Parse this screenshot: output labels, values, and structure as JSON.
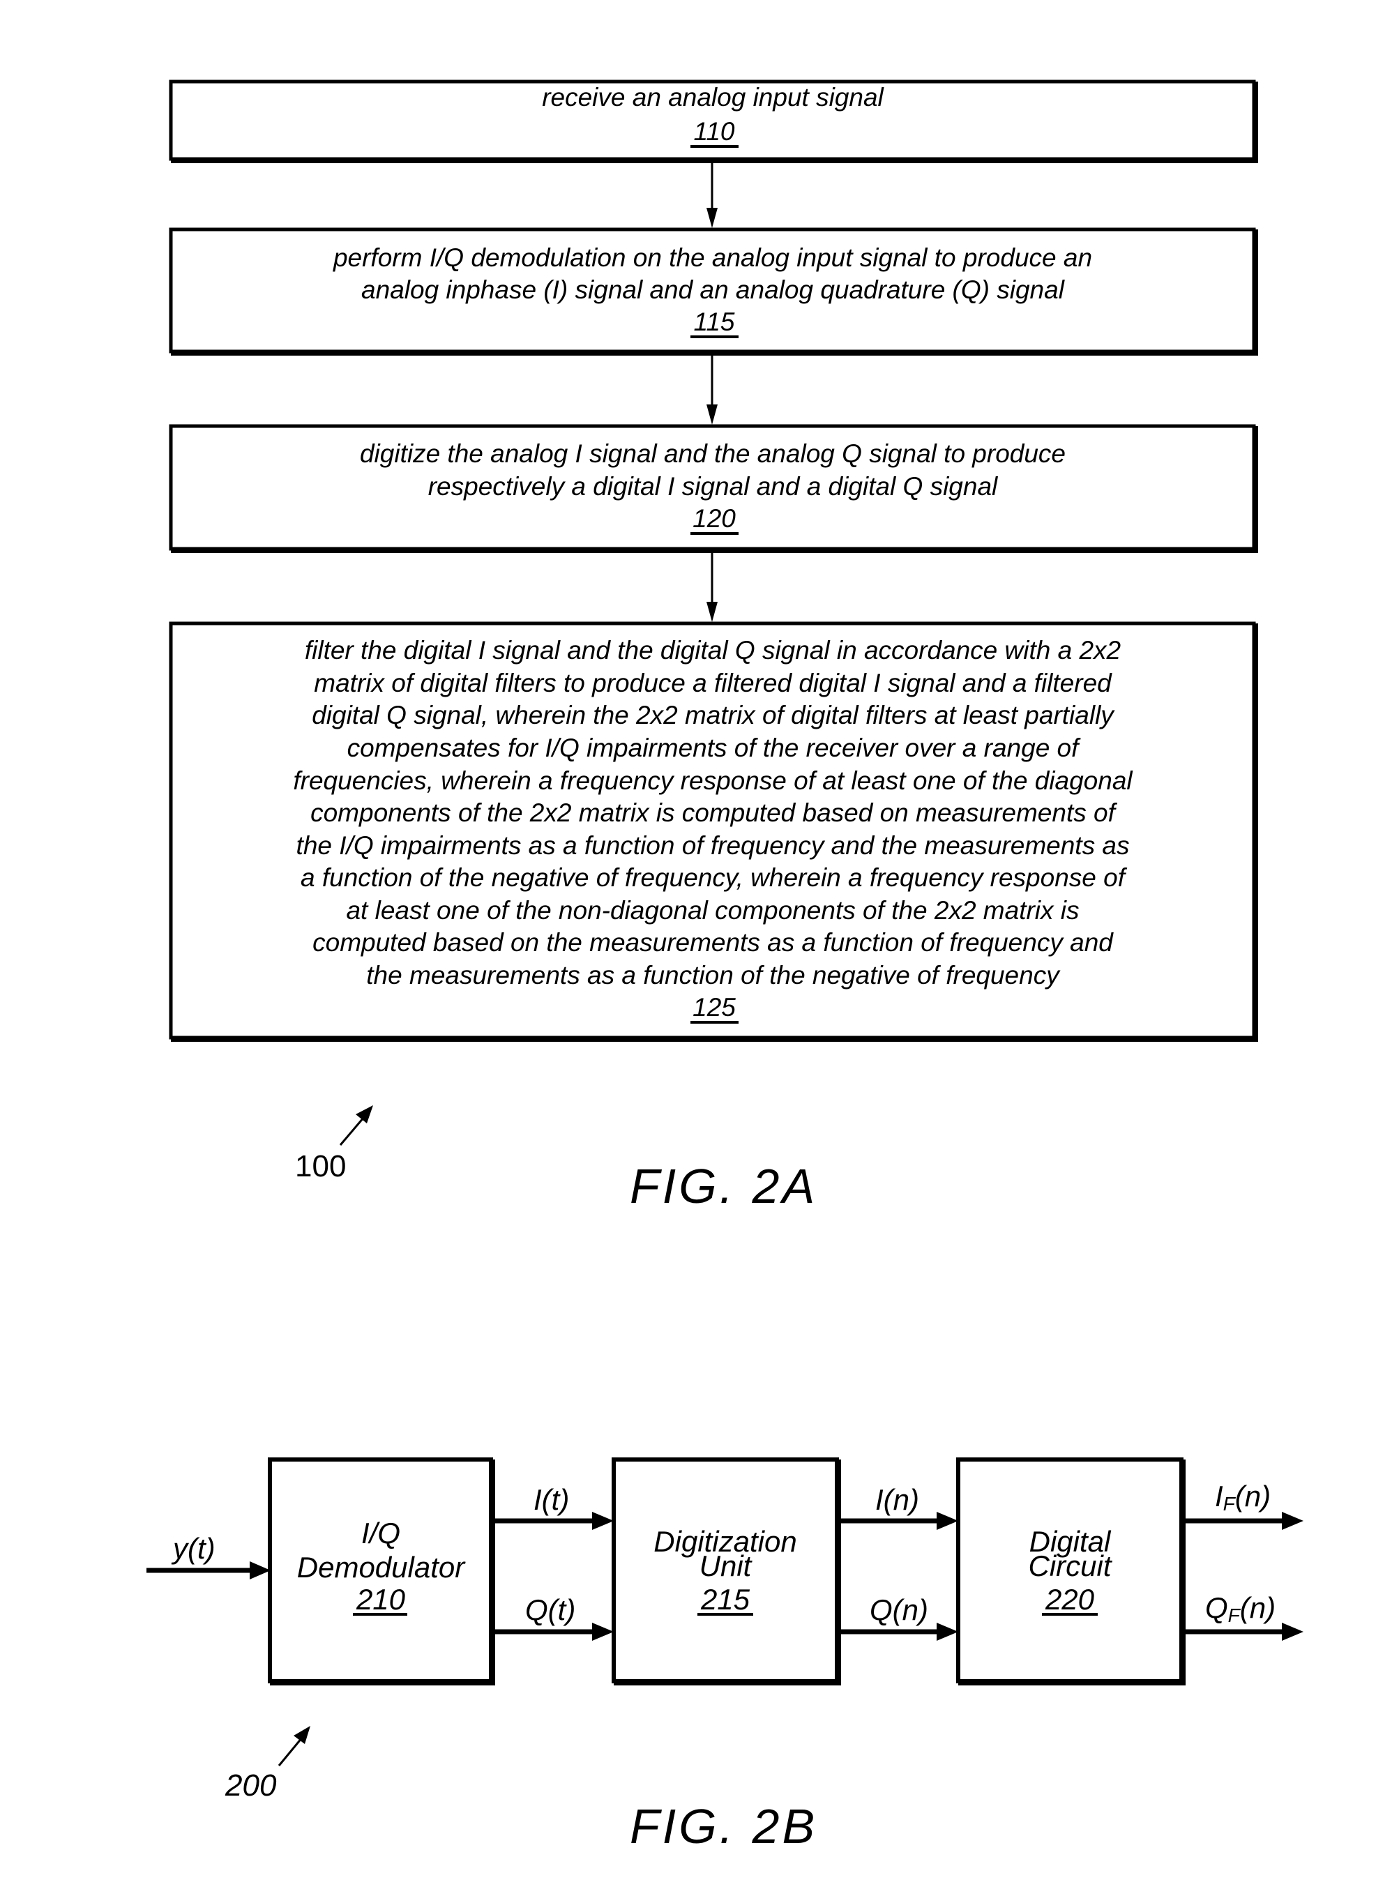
{
  "fig2a": {
    "caption": "FIG. 2A",
    "reference": "100",
    "steps": [
      {
        "lines": [
          "receive an analog input signal"
        ],
        "ref": "110"
      },
      {
        "lines": [
          "perform I/Q demodulation on the analog input signal to produce an",
          "analog inphase (I) signal and an analog quadrature (Q) signal"
        ],
        "ref": "115"
      },
      {
        "lines": [
          "digitize the analog I signal and the analog Q signal to produce",
          "respectively a digital I signal and a digital Q signal"
        ],
        "ref": "120"
      },
      {
        "lines": [
          "filter the digital I signal and the digital Q signal in accordance with a 2x2",
          "matrix of digital filters to produce a filtered digital I signal and a filtered",
          "digital Q signal, wherein the 2x2 matrix of digital filters at least partially",
          "compensates for I/Q impairments of the receiver over a range of",
          "frequencies, wherein a frequency response of at least one of the diagonal",
          "components of the 2x2 matrix  is computed based on measurements of",
          "the I/Q impairments as a function of frequency and the measurements as",
          "a function of the negative of frequency, wherein a frequency response of",
          "at least one of the non-diagonal components of the 2x2 matrix is",
          "computed based on the measurements as a function of frequency and",
          "the measurements as a function of the negative of frequency"
        ],
        "ref": "125"
      }
    ]
  },
  "fig2b": {
    "caption": "FIG. 2B",
    "reference": "200",
    "input_signal": "y(t)",
    "blocks": [
      {
        "lines": [
          "I/Q",
          "Demodulator"
        ],
        "ref": "210"
      },
      {
        "lines": [
          "Digitization",
          "Unit"
        ],
        "ref": "215"
      },
      {
        "lines": [
          "Digital",
          "Circuit"
        ],
        "ref": "220"
      }
    ],
    "signals": {
      "i_t": "I(t)",
      "q_t": "Q(t)",
      "i_n": "I(n)",
      "q_n": "Q(n)",
      "if_main": "I",
      "if_sub": "F",
      "if_tail": "(n)",
      "qf_main": "Q",
      "qf_sub": "F",
      "qf_tail": "(n)"
    }
  }
}
